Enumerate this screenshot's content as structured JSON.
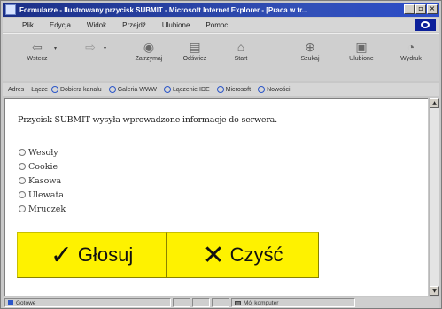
{
  "window": {
    "title": "Formularze - Ilustrowany przycisk SUBMIT - Microsoft Internet Explorer - [Praca w tr..."
  },
  "menu": {
    "items": [
      "Plik",
      "Edycja",
      "Widok",
      "Przejdź",
      "Ulubione",
      "Pomoc"
    ]
  },
  "toolbar": {
    "back": "Wstecz",
    "stop": "Zatrzymaj",
    "refresh": "Odśwież",
    "home": "Start",
    "search": "Szukaj",
    "favorites": "Ulubione",
    "print": "Wydruk"
  },
  "linksbar": {
    "address_label": "Adres",
    "links_label": "Łącze",
    "links": [
      "Dobierz kanału",
      "Galeria WWW",
      "Łączenie IDE",
      "Microsoft",
      "Nowości"
    ]
  },
  "page": {
    "intro": "Przycisk SUBMIT wysyła wprowadzone informacje do serwera.",
    "options": [
      "Wesoły",
      "Cookie",
      "Kasowa",
      "Ulewata",
      "Mruczek"
    ],
    "vote_label": "Głosuj",
    "clear_label": "Czyść",
    "accent_color": "#fef200"
  },
  "status": {
    "left": "Gotowe",
    "zone": "Mój komputer"
  }
}
